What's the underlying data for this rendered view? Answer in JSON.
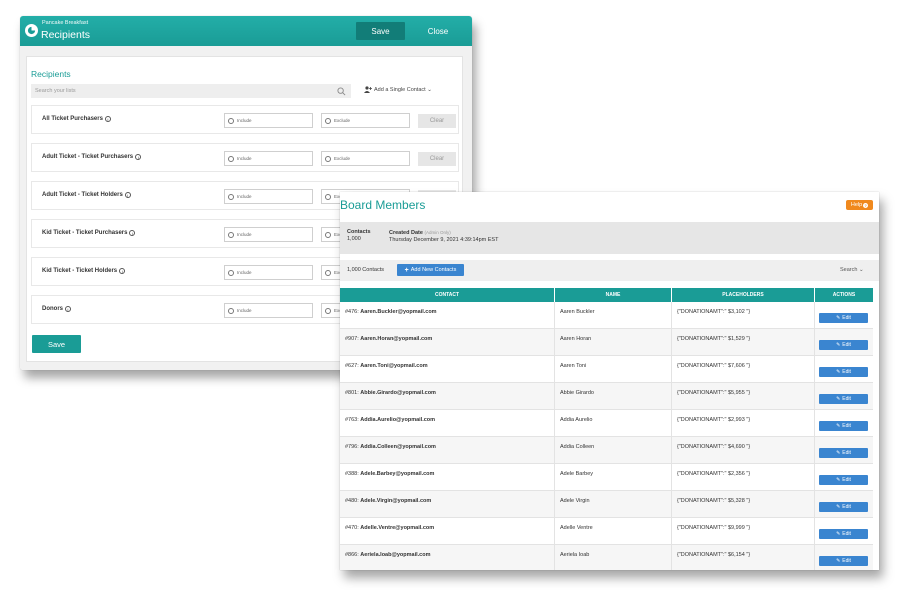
{
  "recipients_window": {
    "org_name": "Pancake Breakfast",
    "title": "Recipients",
    "save_label": "Save",
    "close_label": "Close",
    "section_title": "Recipients",
    "search_placeholder": "Search your lists",
    "add_single_contact": "Add a Single Contact ⌄",
    "include_label": "Include",
    "exclude_label": "Exclude",
    "clear_label": "Clear",
    "lists": [
      {
        "name": "All Ticket Purchasers"
      },
      {
        "name": "Adult Ticket - Ticket Purchasers"
      },
      {
        "name": "Adult Ticket - Ticket Holders"
      },
      {
        "name": "Kid Ticket - Ticket Purchasers"
      },
      {
        "name": "Kid Ticket - Ticket Holders"
      },
      {
        "name": "Donors"
      }
    ],
    "bottom_save_label": "Save",
    "colors": {
      "header": "#1a9c96",
      "header_button": "#127d78"
    }
  },
  "board_window": {
    "title": "Board Members",
    "help_label": "Help",
    "info": {
      "contacts_label": "Contacts",
      "contacts_value": "1,000",
      "created_label": "Created Date",
      "created_note": "(Admin Only)",
      "created_value": "Thursday December 9, 2021 4:39:14pm EST"
    },
    "contact_count": "1,000 Contacts",
    "add_button": "Add New Contacts",
    "search_label": "Search ⌄",
    "columns": [
      "CONTACT",
      "NAME",
      "PLACEHOLDERS",
      "ACTIONS"
    ],
    "edit_label": "Edit",
    "rows": [
      {
        "id": "#476:",
        "email": "Aaren.Buckler@yopmail.com",
        "name": "Aaren Buckler",
        "placeholder": "{\"DONATIONAMT\":\" $3,102 \"}"
      },
      {
        "id": "#907:",
        "email": "Aaren.Horan@yopmail.com",
        "name": "Aaren Horan",
        "placeholder": "{\"DONATIONAMT\":\" $1,529 \"}"
      },
      {
        "id": "#627:",
        "email": "Aaren.Toni@yopmail.com",
        "name": "Aaren Toni",
        "placeholder": "{\"DONATIONAMT\":\" $7,606 \"}"
      },
      {
        "id": "#801:",
        "email": "Abbie.Girardo@yopmail.com",
        "name": "Abbie Girardo",
        "placeholder": "{\"DONATIONAMT\":\" $5,955 \"}"
      },
      {
        "id": "#763:",
        "email": "Addia.Aurelio@yopmail.com",
        "name": "Addia Aurelio",
        "placeholder": "{\"DONATIONAMT\":\" $2,993 \"}"
      },
      {
        "id": "#796:",
        "email": "Addia.Colleen@yopmail.com",
        "name": "Addia Colleen",
        "placeholder": "{\"DONATIONAMT\":\" $4,690 \"}"
      },
      {
        "id": "#388:",
        "email": "Adele.Barbey@yopmail.com",
        "name": "Adele Barbey",
        "placeholder": "{\"DONATIONAMT\":\" $2,356 \"}"
      },
      {
        "id": "#480:",
        "email": "Adele.Virgin@yopmail.com",
        "name": "Adele Virgin",
        "placeholder": "{\"DONATIONAMT\":\" $5,328 \"}"
      },
      {
        "id": "#470:",
        "email": "Adelle.Ventre@yopmail.com",
        "name": "Adelle Ventre",
        "placeholder": "{\"DONATIONAMT\":\" $9,999 \"}"
      },
      {
        "id": "#866:",
        "email": "Aeriela.Ioab@yopmail.com",
        "name": "Aeriela Ioab",
        "placeholder": "{\"DONATIONAMT\":\" $6,154 \"}"
      }
    ],
    "colors": {
      "title": "#1a9c96",
      "table_header": "#1a9c96",
      "button": "#3a85d0",
      "help": "#f0891e"
    }
  }
}
